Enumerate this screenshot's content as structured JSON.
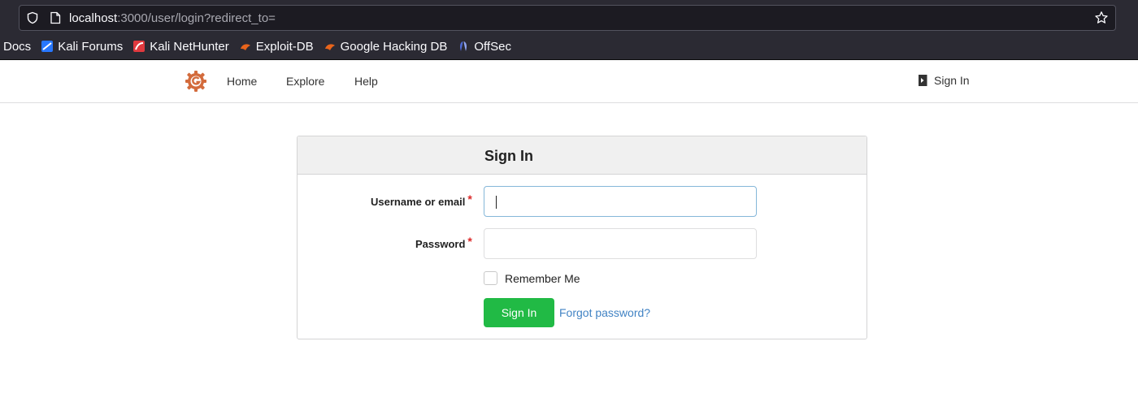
{
  "browser": {
    "url_host": "localhost",
    "url_rest": ":3000/user/login?redirect_to=",
    "bookmarks": [
      {
        "label": "Docs",
        "icon": "none"
      },
      {
        "label": "Kali Forums",
        "icon": "kali-forums-icon"
      },
      {
        "label": "Kali NetHunter",
        "icon": "kali-nethunter-icon"
      },
      {
        "label": "Exploit-DB",
        "icon": "exploit-db-icon"
      },
      {
        "label": "Google Hacking DB",
        "icon": "ghdb-icon"
      },
      {
        "label": "OffSec",
        "icon": "offsec-icon"
      }
    ]
  },
  "header": {
    "logo": "gitea-logo",
    "nav": {
      "home": "Home",
      "explore": "Explore",
      "help": "Help"
    },
    "sign_in": "Sign In"
  },
  "login": {
    "title": "Sign In",
    "username_label": "Username or email",
    "username_value": "",
    "password_label": "Password",
    "password_value": "",
    "required_mark": "*",
    "remember_label": "Remember Me",
    "remember_checked": false,
    "submit": "Sign In",
    "forgot": "Forgot password?"
  },
  "colors": {
    "brand": "#d36b3c",
    "accent_green": "#21ba45",
    "link": "#4183c4",
    "required": "#db2828"
  }
}
